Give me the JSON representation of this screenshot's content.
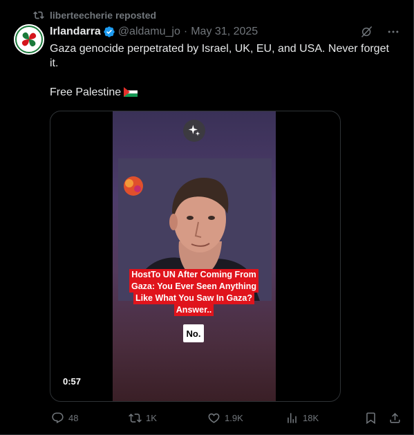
{
  "repost": {
    "text": "liberteecherie reposted",
    "icon": "repost-icon"
  },
  "author": {
    "name": "Irlandarra",
    "handle": "@aldamu_jo",
    "separator": "·",
    "date": "May 31, 2025",
    "verified": true,
    "verified_color": "#1d9bf0"
  },
  "tweet": {
    "text": "Gaza genocide perpetrated by Israel,  UK, EU, and USA. Never forget it.\n\nFree Palestine",
    "flag": "palestine-flag"
  },
  "media": {
    "caption_lines": [
      "HostTo UN After Coming From",
      "Gaza:   You Ever Seen Anything",
      "Like What You Saw In Gaza?",
      "Answer.."
    ],
    "answer": "No.",
    "duration": "0:57",
    "caption_color": "#e0141c"
  },
  "actions": {
    "replies": "48",
    "reposts": "1K",
    "likes": "1.9K",
    "views": "18K"
  },
  "colors": {
    "background": "#000000",
    "text": "#e7e9ea",
    "muted": "#71767b",
    "border": "#2f3336"
  }
}
